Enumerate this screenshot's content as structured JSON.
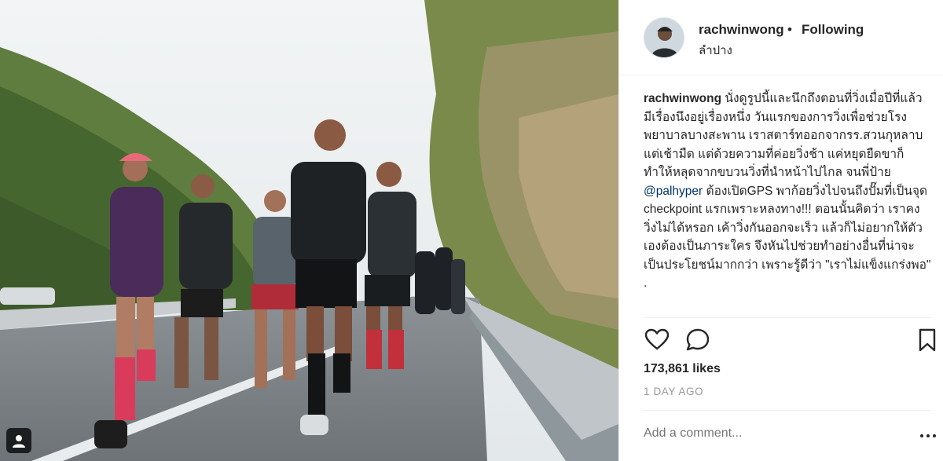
{
  "post": {
    "username": "rachwinwong",
    "separator": "•",
    "follow_status": "Following",
    "location": "ลำปาง",
    "caption": {
      "username": "rachwinwong",
      "text_before_mention": "นั่งดูรูปนี้และนึกถึงตอนที่วิ่งเมื่อปีที่แล้ว มีเรื่องนึงอยู่เรื่องหนึ่ง วันแรกของการวิ่งเพื่อช่วยโรงพยาบาลบางสะพาน เราสตาร์ทออกจากรร.สวนกุหลาบแต่เช้ามืด แต่ด้วยความที่ค่อยวิ่งช้า แค่หยุดยืดขาก็ทำให้หลุดจากขบวนวิ่งที่นำหน้าไปไกล จนพี่ป้าย ",
      "mention": "@palhyper",
      "text_after_mention": " ต้องเปิดGPS พาก้อยวิ่งไปจนถึงปั๊มที่เป็นจุด checkpoint แรกเพราะหลงทาง!!! ตอนนั้นคิดว่า เราคงวิ่งไม่ได้หรอก เค้าวิ่งกันออกจะเร็ว แล้วก็ไม่อยากให้ตัวเองต้องเป็นภาระใคร จึงหันไปช่วยทำอย่างอื่นที่น่าจะเป็นประโยชน์มากกว่า เพราะรู้ดีว่า \"เราไม่แข็งแกร่งพอ\" ."
    },
    "likes": "173,861 likes",
    "timestamp": "1 DAY AGO",
    "comment_placeholder": "Add a comment..."
  },
  "icons": {
    "like": "heart-icon",
    "comment": "comment-bubble-icon",
    "save": "bookmark-icon",
    "options": "more-options-icon",
    "tagged": "user-tag-icon"
  },
  "colors": {
    "text": "#262626",
    "muted": "#999999",
    "divider": "#efefef",
    "mention": "#003569"
  }
}
